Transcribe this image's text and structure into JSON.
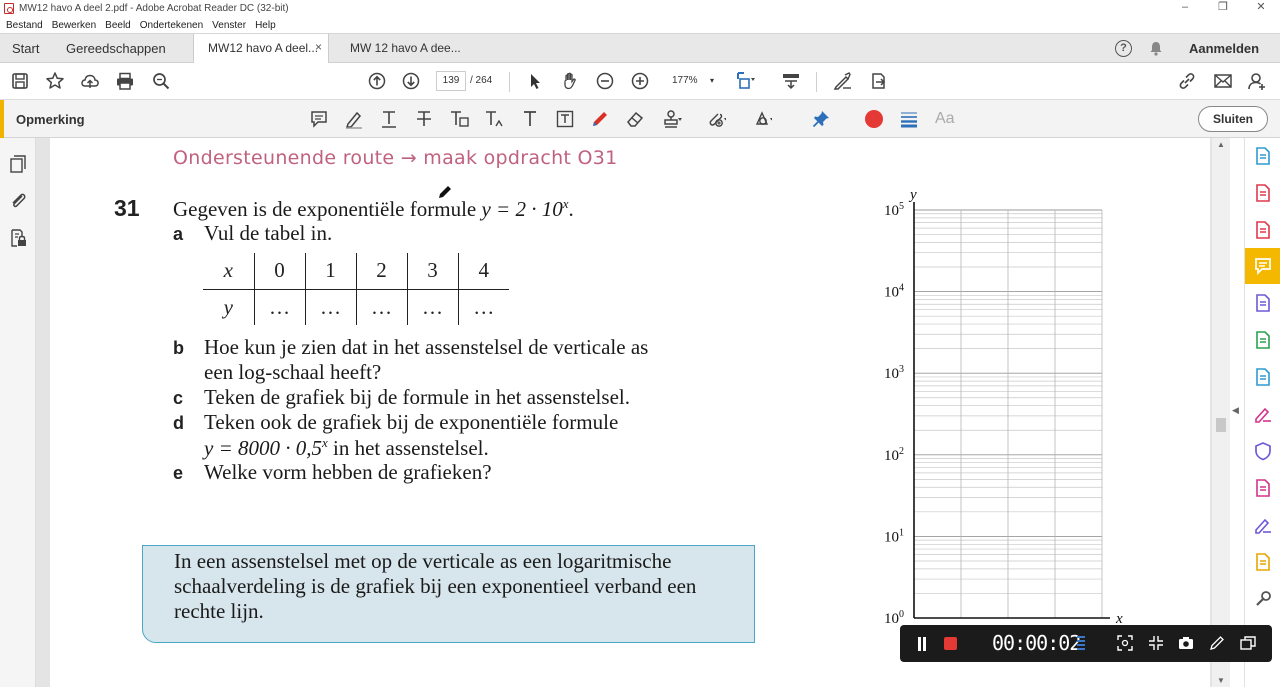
{
  "window": {
    "title": "MW12 havo A deel 2.pdf - Adobe Acrobat Reader DC (32-bit)",
    "controls": [
      "–",
      "❐",
      "✕"
    ]
  },
  "menu": [
    "Bestand",
    "Bewerken",
    "Beeld",
    "Ondertekenen",
    "Venster",
    "Help"
  ],
  "tabs": {
    "home": "Start",
    "tools": "Gereedschappen",
    "doc_active": "MW12 havo A deel...",
    "doc_other": "MW 12 havo A dee...",
    "close": "×",
    "help": "?",
    "signin": "Aanmelden"
  },
  "toolbar": {
    "page_current": "139",
    "page_total": "/  264",
    "zoom": "177%",
    "zoom_caret": "▾"
  },
  "comment_bar": {
    "label": "Opmerking",
    "close": "Sluiten",
    "text_props": "Aa",
    "color_accent": "#f0b400",
    "record_color": "#e53935"
  },
  "scroll": {
    "up": "▲",
    "down": "▼",
    "collapse_left": "◀",
    "collapse_right": "◀"
  },
  "document": {
    "route": "Ondersteunende route → maak opdracht O31",
    "question_number": "31",
    "intro_pre": "Gegeven is de exponentiële formule ",
    "intro_formula": "y = 2 · 10",
    "intro_exp": "x",
    "intro_post": ".",
    "items": [
      {
        "letter": "a",
        "lines": [
          "Vul de tabel in."
        ]
      },
      {
        "letter": "b",
        "lines": [
          "Hoe kun je zien dat in het assenstelsel de verticale as",
          "een log-schaal heeft?"
        ]
      },
      {
        "letter": "c",
        "lines": [
          "Teken de grafiek bij de formule in het assenstelsel."
        ]
      },
      {
        "letter": "d",
        "lines": [
          "Teken ook de grafiek bij de exponentiële formule"
        ]
      },
      {
        "letter": "e",
        "lines": [
          "Welke vorm hebben de grafieken?"
        ]
      }
    ],
    "d_formula": "y = 8000 · 0,5",
    "d_exp": "x",
    "d_post": " in het assenstelsel.",
    "table": {
      "x_label": "x",
      "y_label": "y",
      "x_values": [
        "0",
        "1",
        "2",
        "3",
        "4"
      ],
      "y_values": [
        "…",
        "…",
        "…",
        "…",
        "…"
      ]
    },
    "rule_lines": [
      "In een assenstelsel met op de verticale as een logaritmische",
      "schaalverdeling is de grafiek bij een exponentieel verband een",
      "rechte lijn."
    ],
    "graph": {
      "y_axis_label": "y",
      "x_axis_label": "x",
      "y_scale": "log",
      "y_ticks": [
        {
          "base": "10",
          "exp": "0"
        },
        {
          "base": "10",
          "exp": "1"
        },
        {
          "base": "10",
          "exp": "2"
        },
        {
          "base": "10",
          "exp": "3"
        },
        {
          "base": "10",
          "exp": "4"
        },
        {
          "base": "10",
          "exp": "5"
        }
      ],
      "x_columns": 4,
      "grid": true
    }
  },
  "recorder": {
    "timer": "00:00:02"
  }
}
